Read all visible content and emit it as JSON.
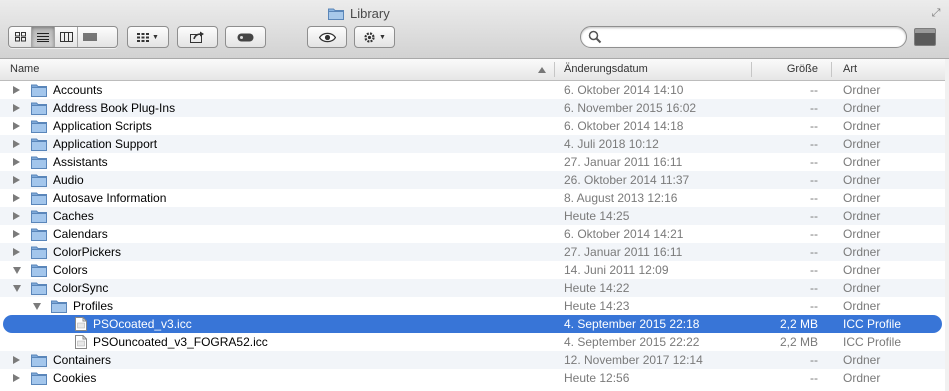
{
  "window": {
    "title": "Library"
  },
  "toolbar": {
    "view_buttons": [
      "icon-view-icon",
      "list-view-icon",
      "column-view-icon",
      "coverflow-view-icon"
    ],
    "search": {
      "value": "",
      "placeholder": ""
    }
  },
  "columns": {
    "name": "Name",
    "date": "Änderungsdatum",
    "size": "Größe",
    "kind": "Art"
  },
  "rows": [
    {
      "level": 0,
      "disclosure": "closed",
      "type": "folder",
      "name": "Accounts",
      "date": "6. Oktober 2014 14:10",
      "size": "--",
      "kind": "Ordner"
    },
    {
      "level": 0,
      "disclosure": "closed",
      "type": "folder",
      "name": "Address Book Plug-Ins",
      "date": "6. November 2015 16:02",
      "size": "--",
      "kind": "Ordner"
    },
    {
      "level": 0,
      "disclosure": "closed",
      "type": "folder",
      "name": "Application Scripts",
      "date": "6. Oktober 2014 14:18",
      "size": "--",
      "kind": "Ordner"
    },
    {
      "level": 0,
      "disclosure": "closed",
      "type": "folder",
      "name": "Application Support",
      "date": "4. Juli 2018 10:12",
      "size": "--",
      "kind": "Ordner"
    },
    {
      "level": 0,
      "disclosure": "closed",
      "type": "folder",
      "name": "Assistants",
      "date": "27. Januar 2011 16:11",
      "size": "--",
      "kind": "Ordner"
    },
    {
      "level": 0,
      "disclosure": "closed",
      "type": "folder",
      "name": "Audio",
      "date": "26. Oktober 2014 11:37",
      "size": "--",
      "kind": "Ordner"
    },
    {
      "level": 0,
      "disclosure": "closed",
      "type": "folder",
      "name": "Autosave Information",
      "date": "8. August 2013 12:16",
      "size": "--",
      "kind": "Ordner"
    },
    {
      "level": 0,
      "disclosure": "closed",
      "type": "folder",
      "name": "Caches",
      "date": "Heute 14:25",
      "size": "--",
      "kind": "Ordner"
    },
    {
      "level": 0,
      "disclosure": "closed",
      "type": "folder",
      "name": "Calendars",
      "date": "6. Oktober 2014 14:21",
      "size": "--",
      "kind": "Ordner"
    },
    {
      "level": 0,
      "disclosure": "closed",
      "type": "folder",
      "name": "ColorPickers",
      "date": "27. Januar 2011 16:11",
      "size": "--",
      "kind": "Ordner"
    },
    {
      "level": 0,
      "disclosure": "open",
      "type": "folder",
      "name": "Colors",
      "date": "14. Juni 2011 12:09",
      "size": "--",
      "kind": "Ordner"
    },
    {
      "level": 0,
      "disclosure": "open",
      "type": "folder",
      "name": "ColorSync",
      "date": "Heute 14:22",
      "size": "--",
      "kind": "Ordner"
    },
    {
      "level": 1,
      "disclosure": "open",
      "type": "folder",
      "name": "Profiles",
      "date": "Heute 14:23",
      "size": "--",
      "kind": "Ordner"
    },
    {
      "level": 2,
      "disclosure": "none",
      "type": "file",
      "name": "PSOcoated_v3.icc",
      "date": "4. September 2015 22:18",
      "size": "2,2 MB",
      "kind": "ICC Profile",
      "selected": true
    },
    {
      "level": 2,
      "disclosure": "none",
      "type": "file",
      "name": "PSOuncoated_v3_FOGRA52.icc",
      "date": "4. September 2015 22:22",
      "size": "2,2 MB",
      "kind": "ICC Profile"
    },
    {
      "level": 0,
      "disclosure": "closed",
      "type": "folder",
      "name": "Containers",
      "date": "12. November 2017 12:14",
      "size": "--",
      "kind": "Ordner"
    },
    {
      "level": 0,
      "disclosure": "closed",
      "type": "folder",
      "name": "Cookies",
      "date": "Heute 12:56",
      "size": "--",
      "kind": "Ordner"
    }
  ],
  "colors": {
    "selection": "#3875d7",
    "folder": "#8ab4e0",
    "alt_row": "#f2f5f9"
  }
}
